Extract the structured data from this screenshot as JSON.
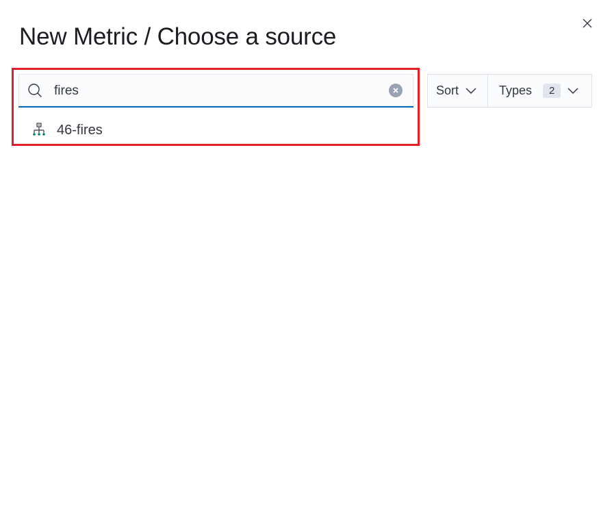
{
  "modal": {
    "title": "New Metric / Choose a source",
    "close_icon": "close-icon"
  },
  "search": {
    "value": "fires",
    "placeholder": "Search…",
    "search_icon": "search-icon",
    "clear_icon": "clear-input-icon"
  },
  "results": [
    {
      "label": "46-fires",
      "icon": "index-pattern-icon"
    }
  ],
  "filters": {
    "sort_label": "Sort",
    "types_label": "Types",
    "types_count": "2",
    "chevron_icon": "chevron-down-icon"
  },
  "colors": {
    "highlight": "#e3202a",
    "focus_underline": "#006bb8",
    "result_icon": "#017d73",
    "clear_button": "#98a2b3"
  }
}
